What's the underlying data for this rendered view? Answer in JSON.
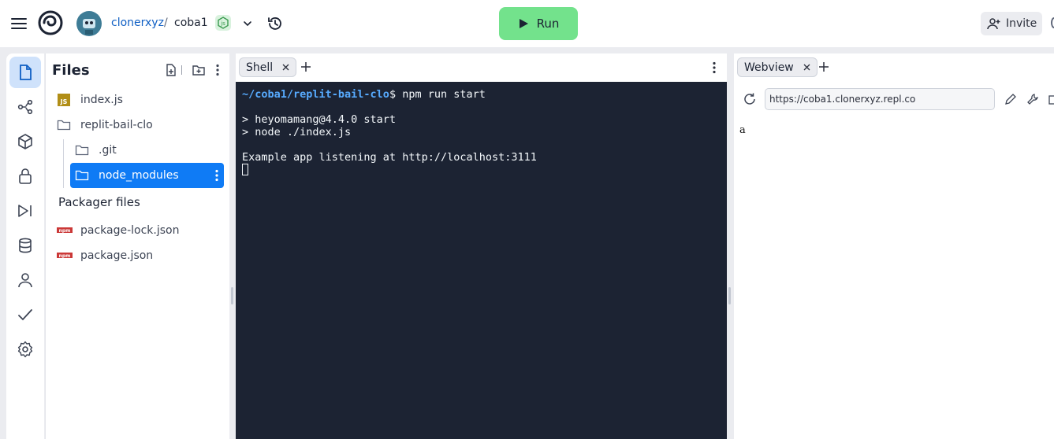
{
  "header": {
    "owner": "clonerxyz",
    "separator": "/",
    "repl_name": "coba1",
    "run_label": "Run",
    "invite_label": "Invite"
  },
  "sidebar_rail": {
    "items": [
      {
        "icon": "file-icon",
        "active": true
      },
      {
        "icon": "git-branch-icon"
      },
      {
        "icon": "package-cube-icon"
      },
      {
        "icon": "lock-icon"
      },
      {
        "icon": "run-step-icon"
      },
      {
        "icon": "database-icon"
      },
      {
        "icon": "user-icon"
      },
      {
        "icon": "checkmark-icon"
      },
      {
        "icon": "gear-icon"
      }
    ]
  },
  "files": {
    "title": "Files",
    "items": [
      {
        "name": "index.js",
        "type": "js"
      },
      {
        "name": "replit-bail-clo",
        "type": "folder"
      },
      {
        "name": ".git",
        "type": "folder"
      },
      {
        "name": "node_modules",
        "type": "folder",
        "selected": true
      }
    ],
    "packager_title": "Packager files",
    "packager_items": [
      {
        "name": "package-lock.json"
      },
      {
        "name": "package.json"
      }
    ]
  },
  "shell": {
    "tab_label": "Shell",
    "prompt_path": "~/coba1/replit-bail-clo",
    "prompt_cmd": "$ npm run start",
    "lines": [
      "",
      "> heyomamang@4.4.0 start",
      "> node ./index.js",
      "",
      "Example app listening at http://localhost:3111"
    ]
  },
  "webview": {
    "tab_label": "Webview",
    "url": "https://coba1.clonerxyz.repl.co",
    "body_text": "a"
  },
  "colors": {
    "accent": "#0f7bf5",
    "run_green": "#73e28c",
    "terminal_bg": "#1c2333",
    "prompt_blue": "#57abff"
  }
}
